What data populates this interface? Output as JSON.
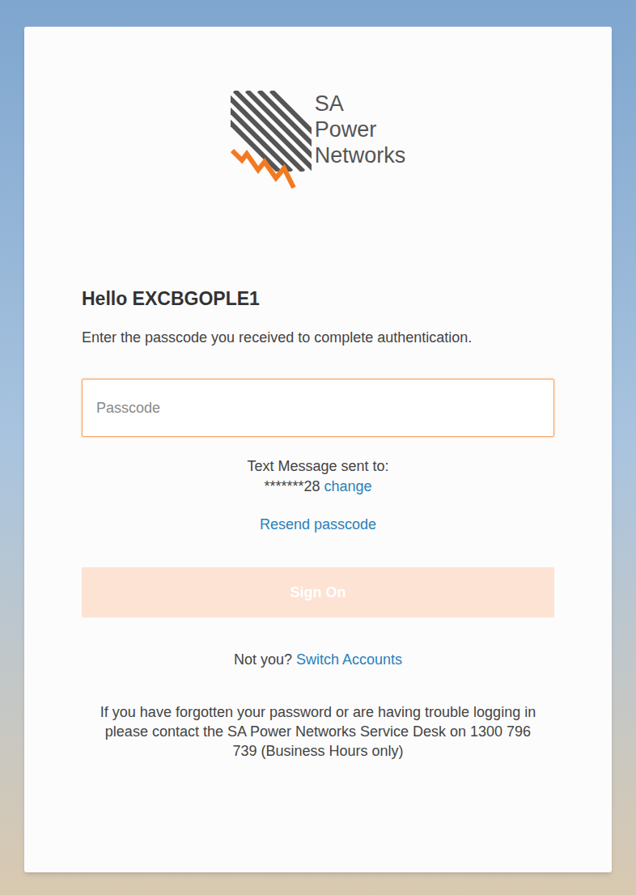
{
  "logo": {
    "lines": [
      "SA",
      "Power",
      "Networks"
    ]
  },
  "greeting": "Hello EXCBGOPLE1",
  "instruction": "Enter the passcode you received to complete authentication.",
  "passcode_field": {
    "placeholder": "Passcode",
    "value": "",
    "focused": true
  },
  "delivery": {
    "label": "Text Message sent to:",
    "masked_number": "*******28",
    "change_link": "change"
  },
  "resend_link": "Resend passcode",
  "sign_on_button": {
    "label": "Sign On",
    "disabled": true
  },
  "switch_account": {
    "prompt": "Not you?",
    "link": "Switch Accounts"
  },
  "help_text": "If you have forgotten your password or are having trouble logging in please contact the SA Power Networks Service Desk on 1300 796 739 (Business Hours only)"
}
